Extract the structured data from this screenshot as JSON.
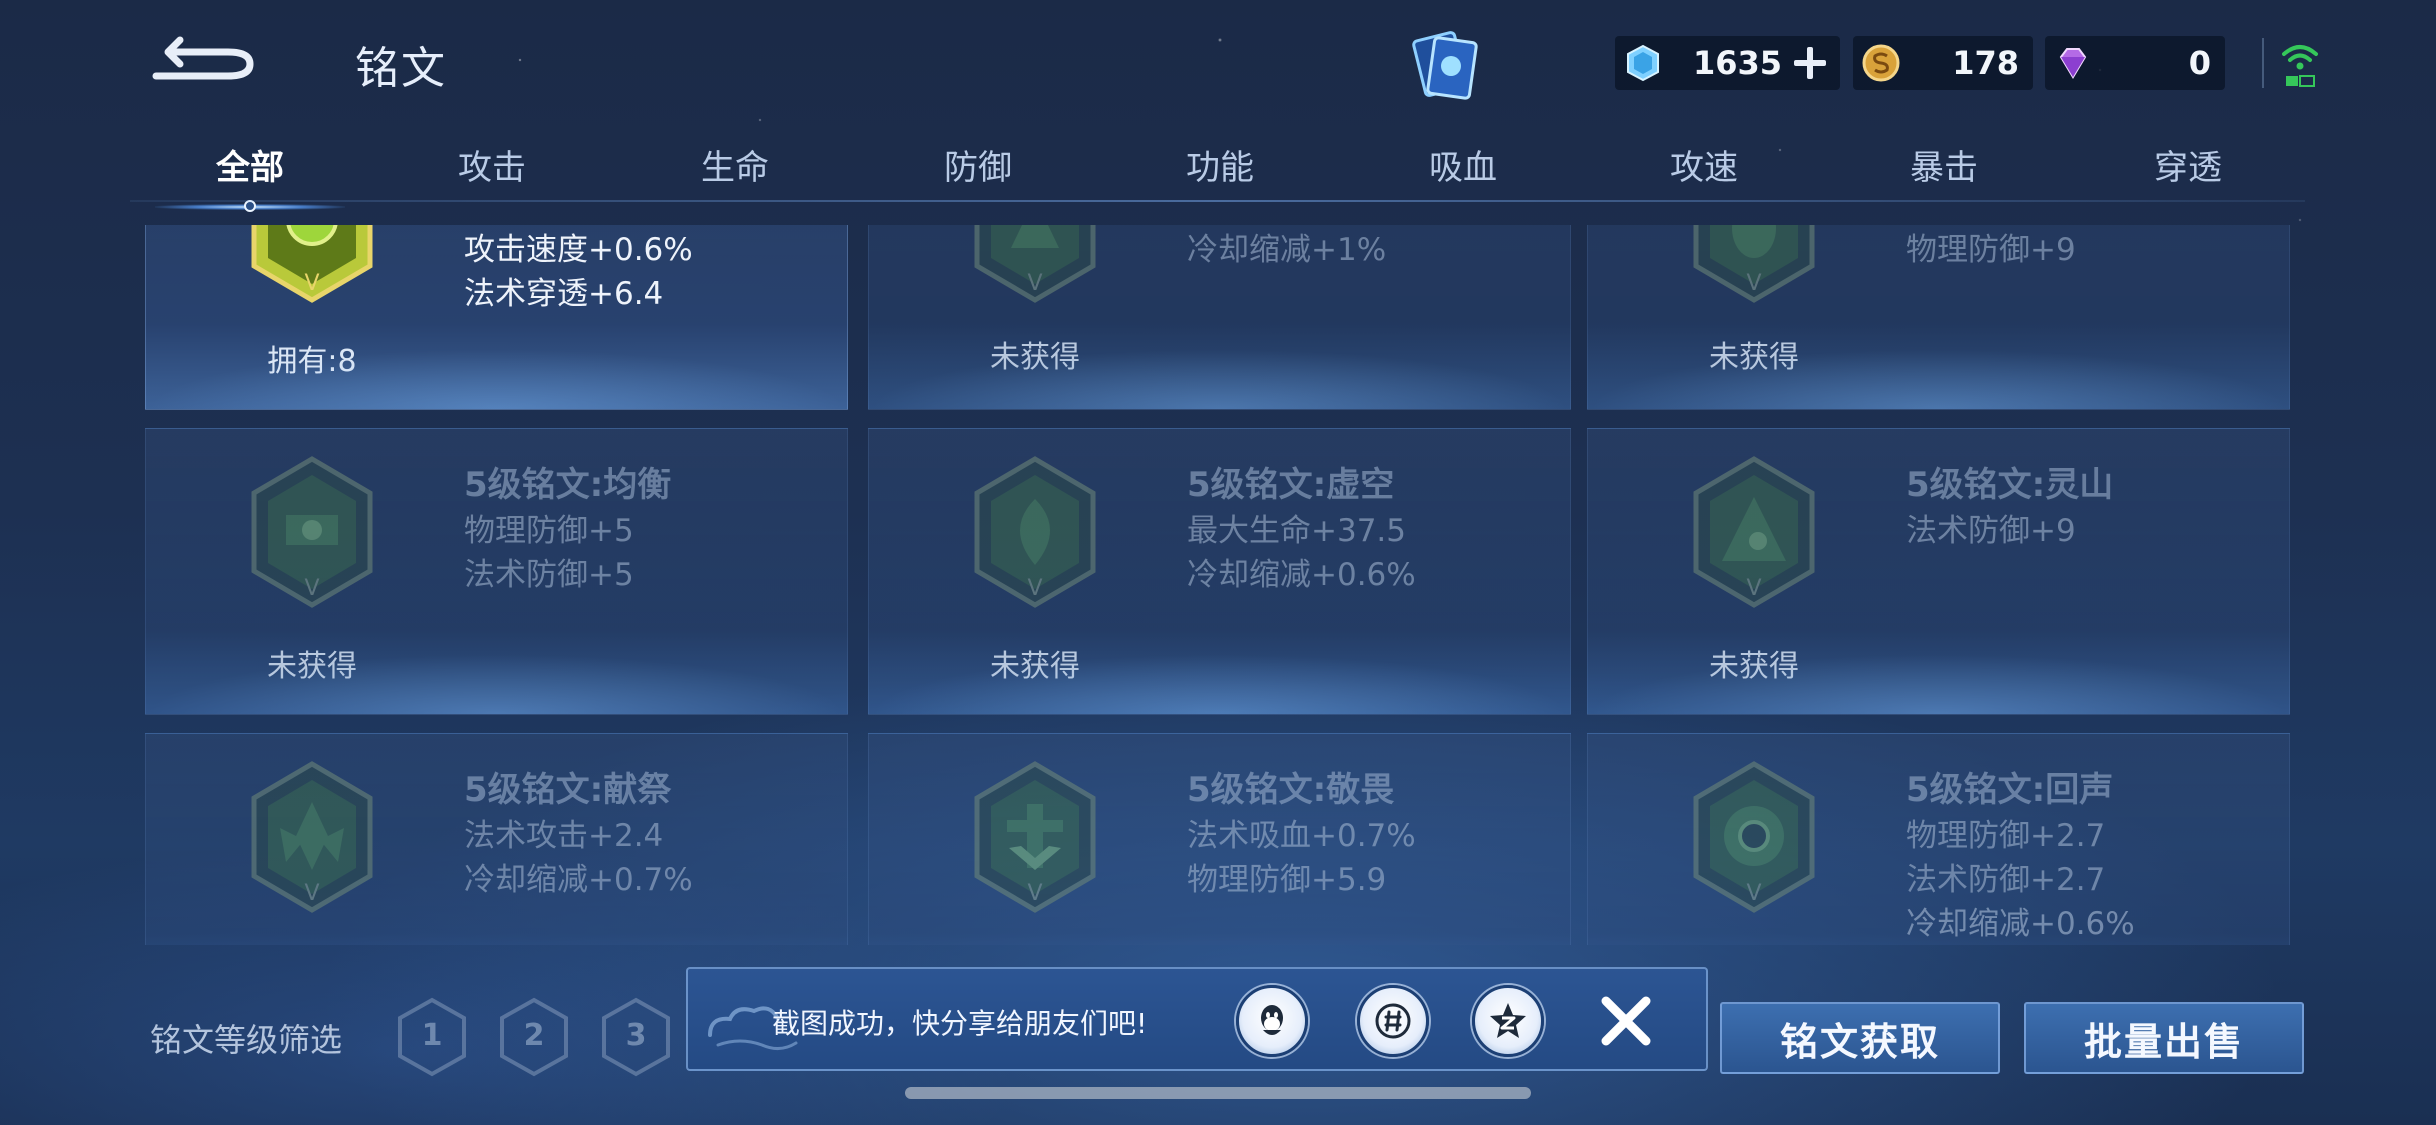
{
  "header": {
    "title": "铭文",
    "currencies": [
      {
        "icon": "crystal-icon",
        "value": "1635"
      },
      {
        "icon": "gold-coin-icon",
        "value": "178"
      },
      {
        "icon": "diamond-icon",
        "value": "0"
      }
    ]
  },
  "tabs": [
    {
      "label": "全部",
      "active": true
    },
    {
      "label": "攻击"
    },
    {
      "label": "生命"
    },
    {
      "label": "防御"
    },
    {
      "label": "功能"
    },
    {
      "label": "吸血"
    },
    {
      "label": "攻速"
    },
    {
      "label": "暴击"
    },
    {
      "label": "穿透"
    }
  ],
  "runes": {
    "row0": [
      {
        "name": "",
        "attrs": [
          "攻击速度+0.6%",
          "法术穿透+6.4"
        ],
        "status": "拥有:8",
        "owned": true
      },
      {
        "name": "",
        "attrs": [
          "冷却缩减+1%"
        ],
        "status": "未获得"
      },
      {
        "name": "",
        "attrs": [
          "物理防御+9"
        ],
        "status": "未获得"
      }
    ],
    "row1": [
      {
        "name": "5级铭文:均衡",
        "attrs": [
          "物理防御+5",
          "法术防御+5"
        ],
        "status": "未获得"
      },
      {
        "name": "5级铭文:虚空",
        "attrs": [
          "最大生命+37.5",
          "冷却缩减+0.6%"
        ],
        "status": "未获得"
      },
      {
        "name": "5级铭文:灵山",
        "attrs": [
          "法术防御+9"
        ],
        "status": "未获得"
      }
    ],
    "row2": [
      {
        "name": "5级铭文:献祭",
        "attrs": [
          "法术攻击+2.4",
          "冷却缩减+0.7%"
        ],
        "status": ""
      },
      {
        "name": "5级铭文:敬畏",
        "attrs": [
          "法术吸血+0.7%",
          "物理防御+5.9"
        ],
        "status": ""
      },
      {
        "name": "5级铭文:回声",
        "attrs": [
          "物理防御+2.7",
          "法术防御+2.7",
          "冷却缩减+0.6%"
        ],
        "status": ""
      }
    ]
  },
  "footer": {
    "filter_label": "铭文等级筛选",
    "levels": [
      "1",
      "2",
      "3"
    ],
    "acquire_label": "铭文获取",
    "sell_label": "批量出售"
  },
  "toast": {
    "message": "截图成功，快分享给朋友们吧!",
    "share_targets": [
      "qq-icon",
      "wechat-moments-icon",
      "qzone-icon"
    ]
  },
  "colors": {
    "accent": "#3d6fb0",
    "background": "#1d3052",
    "owned_emblem": "#b9c93a"
  }
}
